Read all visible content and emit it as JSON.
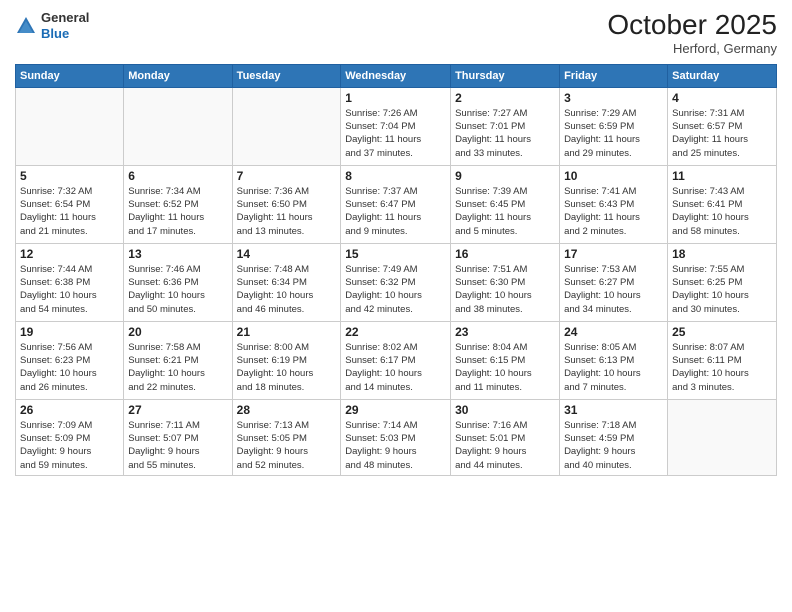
{
  "header": {
    "logo_general": "General",
    "logo_blue": "Blue",
    "month_title": "October 2025",
    "location": "Herford, Germany"
  },
  "weekdays": [
    "Sunday",
    "Monday",
    "Tuesday",
    "Wednesday",
    "Thursday",
    "Friday",
    "Saturday"
  ],
  "weeks": [
    [
      {
        "day": "",
        "info": ""
      },
      {
        "day": "",
        "info": ""
      },
      {
        "day": "",
        "info": ""
      },
      {
        "day": "1",
        "info": "Sunrise: 7:26 AM\nSunset: 7:04 PM\nDaylight: 11 hours\nand 37 minutes."
      },
      {
        "day": "2",
        "info": "Sunrise: 7:27 AM\nSunset: 7:01 PM\nDaylight: 11 hours\nand 33 minutes."
      },
      {
        "day": "3",
        "info": "Sunrise: 7:29 AM\nSunset: 6:59 PM\nDaylight: 11 hours\nand 29 minutes."
      },
      {
        "day": "4",
        "info": "Sunrise: 7:31 AM\nSunset: 6:57 PM\nDaylight: 11 hours\nand 25 minutes."
      }
    ],
    [
      {
        "day": "5",
        "info": "Sunrise: 7:32 AM\nSunset: 6:54 PM\nDaylight: 11 hours\nand 21 minutes."
      },
      {
        "day": "6",
        "info": "Sunrise: 7:34 AM\nSunset: 6:52 PM\nDaylight: 11 hours\nand 17 minutes."
      },
      {
        "day": "7",
        "info": "Sunrise: 7:36 AM\nSunset: 6:50 PM\nDaylight: 11 hours\nand 13 minutes."
      },
      {
        "day": "8",
        "info": "Sunrise: 7:37 AM\nSunset: 6:47 PM\nDaylight: 11 hours\nand 9 minutes."
      },
      {
        "day": "9",
        "info": "Sunrise: 7:39 AM\nSunset: 6:45 PM\nDaylight: 11 hours\nand 5 minutes."
      },
      {
        "day": "10",
        "info": "Sunrise: 7:41 AM\nSunset: 6:43 PM\nDaylight: 11 hours\nand 2 minutes."
      },
      {
        "day": "11",
        "info": "Sunrise: 7:43 AM\nSunset: 6:41 PM\nDaylight: 10 hours\nand 58 minutes."
      }
    ],
    [
      {
        "day": "12",
        "info": "Sunrise: 7:44 AM\nSunset: 6:38 PM\nDaylight: 10 hours\nand 54 minutes."
      },
      {
        "day": "13",
        "info": "Sunrise: 7:46 AM\nSunset: 6:36 PM\nDaylight: 10 hours\nand 50 minutes."
      },
      {
        "day": "14",
        "info": "Sunrise: 7:48 AM\nSunset: 6:34 PM\nDaylight: 10 hours\nand 46 minutes."
      },
      {
        "day": "15",
        "info": "Sunrise: 7:49 AM\nSunset: 6:32 PM\nDaylight: 10 hours\nand 42 minutes."
      },
      {
        "day": "16",
        "info": "Sunrise: 7:51 AM\nSunset: 6:30 PM\nDaylight: 10 hours\nand 38 minutes."
      },
      {
        "day": "17",
        "info": "Sunrise: 7:53 AM\nSunset: 6:27 PM\nDaylight: 10 hours\nand 34 minutes."
      },
      {
        "day": "18",
        "info": "Sunrise: 7:55 AM\nSunset: 6:25 PM\nDaylight: 10 hours\nand 30 minutes."
      }
    ],
    [
      {
        "day": "19",
        "info": "Sunrise: 7:56 AM\nSunset: 6:23 PM\nDaylight: 10 hours\nand 26 minutes."
      },
      {
        "day": "20",
        "info": "Sunrise: 7:58 AM\nSunset: 6:21 PM\nDaylight: 10 hours\nand 22 minutes."
      },
      {
        "day": "21",
        "info": "Sunrise: 8:00 AM\nSunset: 6:19 PM\nDaylight: 10 hours\nand 18 minutes."
      },
      {
        "day": "22",
        "info": "Sunrise: 8:02 AM\nSunset: 6:17 PM\nDaylight: 10 hours\nand 14 minutes."
      },
      {
        "day": "23",
        "info": "Sunrise: 8:04 AM\nSunset: 6:15 PM\nDaylight: 10 hours\nand 11 minutes."
      },
      {
        "day": "24",
        "info": "Sunrise: 8:05 AM\nSunset: 6:13 PM\nDaylight: 10 hours\nand 7 minutes."
      },
      {
        "day": "25",
        "info": "Sunrise: 8:07 AM\nSunset: 6:11 PM\nDaylight: 10 hours\nand 3 minutes."
      }
    ],
    [
      {
        "day": "26",
        "info": "Sunrise: 7:09 AM\nSunset: 5:09 PM\nDaylight: 9 hours\nand 59 minutes."
      },
      {
        "day": "27",
        "info": "Sunrise: 7:11 AM\nSunset: 5:07 PM\nDaylight: 9 hours\nand 55 minutes."
      },
      {
        "day": "28",
        "info": "Sunrise: 7:13 AM\nSunset: 5:05 PM\nDaylight: 9 hours\nand 52 minutes."
      },
      {
        "day": "29",
        "info": "Sunrise: 7:14 AM\nSunset: 5:03 PM\nDaylight: 9 hours\nand 48 minutes."
      },
      {
        "day": "30",
        "info": "Sunrise: 7:16 AM\nSunset: 5:01 PM\nDaylight: 9 hours\nand 44 minutes."
      },
      {
        "day": "31",
        "info": "Sunrise: 7:18 AM\nSunset: 4:59 PM\nDaylight: 9 hours\nand 40 minutes."
      },
      {
        "day": "",
        "info": ""
      }
    ]
  ]
}
